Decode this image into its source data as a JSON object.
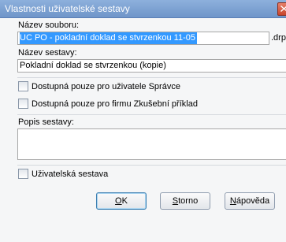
{
  "window": {
    "title": "Vlastnosti uživatelské sestavy"
  },
  "fields": {
    "filename_label": "Název souboru:",
    "filename_value": "UC PO - pokladní doklad se stvrzenkou 11-05",
    "filename_ext": ".drp",
    "report_name_label": "Název sestavy:",
    "report_name_value": "Pokladní doklad se stvrzenkou (kopie)",
    "description_label": "Popis sestavy:",
    "description_value": ""
  },
  "checkboxes": {
    "admin_only": {
      "label": "Dostupná pouze pro uživatele Správce",
      "checked": false
    },
    "company_only": {
      "label": "Dostupná pouze pro firmu Zkušební příklad",
      "checked": false
    },
    "user_report": {
      "label": "Uživatelská sestava",
      "checked": false
    }
  },
  "buttons": {
    "ok": {
      "mnemonic": "O",
      "rest": "K"
    },
    "storno": {
      "mnemonic": "S",
      "rest": "torno"
    },
    "help": {
      "mnemonic": "N",
      "rest": "ápověda"
    }
  },
  "icons": {
    "close": "close-icon"
  }
}
